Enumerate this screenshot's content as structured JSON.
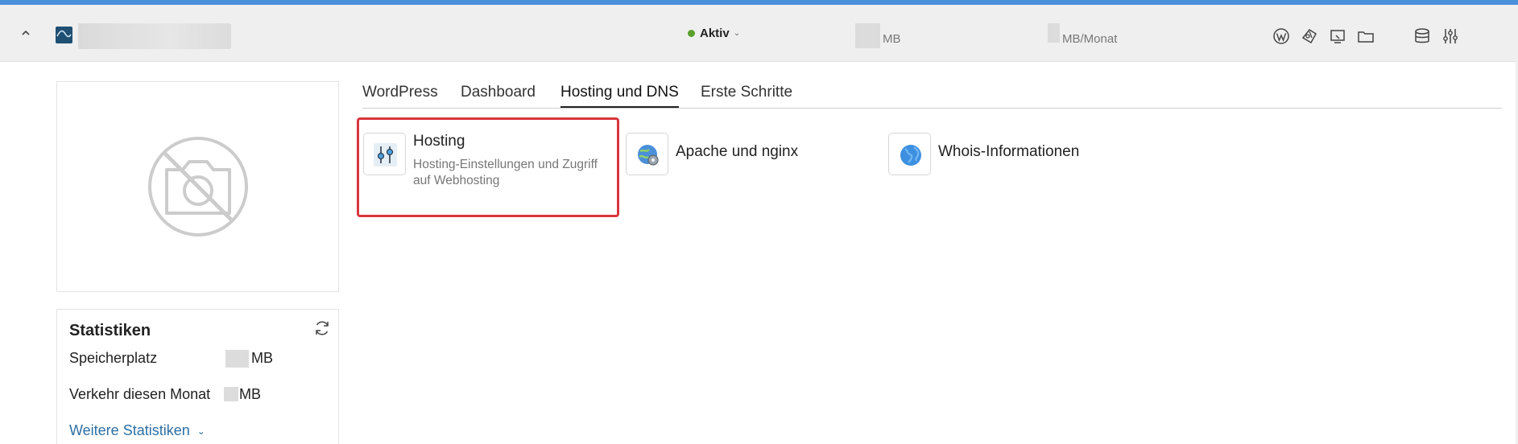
{
  "header": {
    "status_label": "Aktiv",
    "storage_unit": "MB",
    "traffic_unit": "MB/Monat",
    "icons": [
      "wordpress-icon",
      "git-icon",
      "site-preview-icon",
      "folder-icon",
      "database-icon",
      "settings-sliders-icon"
    ]
  },
  "tabs": [
    {
      "label": "WordPress"
    },
    {
      "label": "Dashboard"
    },
    {
      "label": "Hosting und DNS"
    },
    {
      "label": "Erste Schritte"
    }
  ],
  "active_tab": "Hosting und DNS",
  "tiles": [
    {
      "title": "Hosting",
      "description": "Hosting-Einstellungen und Zugriff auf Webhosting",
      "icon": "hosting-sliders-icon"
    },
    {
      "title": "Apache und nginx",
      "icon": "apache-nginx-globe-gear-icon"
    },
    {
      "title": "Whois-Informationen",
      "icon": "whois-globe-icon"
    }
  ],
  "stats": {
    "title": "Statistiken",
    "rows": [
      {
        "label": "Speicherplatz",
        "unit": "MB"
      },
      {
        "label": "Verkehr diesen Monat",
        "unit": "MB"
      }
    ],
    "more_link": "Weitere Statistiken"
  },
  "colors": {
    "accent_top": "#4a90d9",
    "status_active": "#5aa02c",
    "highlight_border": "#d9363e",
    "link": "#2d6ea3"
  }
}
